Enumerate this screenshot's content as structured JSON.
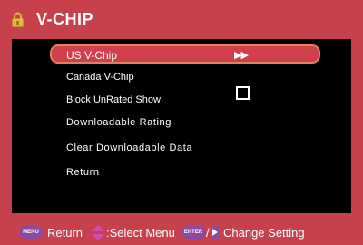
{
  "window": {
    "title": "V-CHIP"
  },
  "menu": {
    "items": [
      {
        "label": "US V-Chip",
        "value": "▶▶"
      },
      {
        "label": "Canada V-Chip"
      },
      {
        "label": "Block UnRated Show"
      },
      {
        "label": "Downloadable Rating"
      },
      {
        "label": "Clear Downloadable Data"
      },
      {
        "label": "Return"
      }
    ]
  },
  "footer": {
    "menu_key": "MENU",
    "return_label": "Return",
    "select_label": ":Select Menu",
    "enter_key": "ENTER",
    "separator": "/",
    "change_label": "Change Setting"
  },
  "colors": {
    "frame": "#c7414c",
    "panel": "#000000",
    "highlight_border": "#e08060",
    "key_purple": "#8a4aa3",
    "lock_gold": "#e3b93a"
  },
  "icons": [
    "lock-icon",
    "up-down-arrows-icon",
    "right-arrow-icon"
  ]
}
